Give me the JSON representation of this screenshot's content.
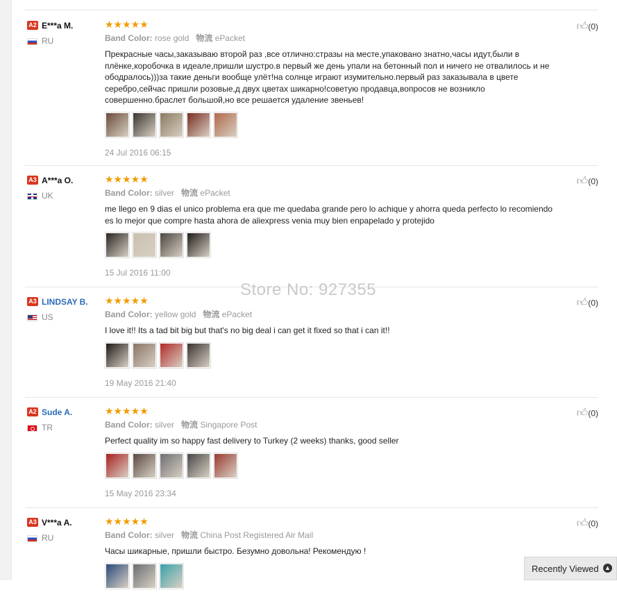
{
  "watermark": "Store No: 927355",
  "recently_viewed": "Recently Viewed",
  "reviews": [
    {
      "level": "A2",
      "name": "E***a M.",
      "flag": "ru",
      "country": "RU",
      "stars": "★★★★★",
      "color_key": "Band Color:",
      "color_val": "rose gold",
      "ship_key": "物流",
      "ship_val": "ePacket",
      "text": "Прекрасные часы,заказываю второй раз ,все отлично:стразы на месте,упаковано знатно,часы идут,были в плёнке,коробочка в идеале,пришли шустро.в первый же день упали на бетонный пол и ничего не отвалилось и не ободралось)))за такие деньги вообще улёт!на солнце играют изумительно.первый раз заказывала в цвете серебро,сейчас пришли розовые,д двух цветах шикарно!советую продавца,вопросов не возникло совершенно.браслет большой,но все решается удаление звеньев!",
      "date": "24 Jul 2016 06:15",
      "likes": "(0)",
      "thumbs": [
        "#6b4b3a",
        "#3a3530",
        "#8a7a60",
        "#7a2c22",
        "#b0684a"
      ]
    },
    {
      "level": "A3",
      "name": "A***a O.",
      "flag": "uk",
      "country": "UK",
      "stars": "★★★★★",
      "color_key": "Band Color:",
      "color_val": "silver",
      "ship_key": "物流",
      "ship_val": "ePacket",
      "text": "me llego en 9 dias el unico problema era que me quedaba grande pero lo achique y ahorra queda perfecto lo recomiendo es lo mejor que compre hasta ahora de aliexpress venia muy bien enpapelado y protejido",
      "date": "15 Jul 2016 11:00",
      "likes": "(0)",
      "thumbs": [
        "#2a2522",
        "#c8bfae",
        "#4a4640",
        "#1e1c1a"
      ]
    },
    {
      "level": "A3",
      "name": "LINDSAY B.",
      "flag": "us",
      "country": "US",
      "stars": "★★★★★",
      "color_key": "Band Color:",
      "color_val": "yellow gold",
      "ship_key": "物流",
      "ship_val": "ePacket",
      "text": "I love it!! Its a tad bit big but that's no big deal i can get it fixed so that i can it!!",
      "date": "19 May 2016 21:40",
      "likes": "(0)",
      "thumbs": [
        "#1e1a18",
        "#8a7466",
        "#b02a2a",
        "#3a3230"
      ]
    },
    {
      "level": "A2",
      "name": "Sude A.",
      "flag": "tr",
      "country": "TR",
      "stars": "★★★★★",
      "color_key": "Band Color:",
      "color_val": "silver",
      "ship_key": "物流",
      "ship_val": "Singapore Post",
      "text": "Perfect quality im so happy fast delivery to Turkey (2 weeks) thanks, good seller",
      "date": "15 May 2016 23:34",
      "likes": "(0)",
      "thumbs": [
        "#a82020",
        "#5a4a44",
        "#6e6e72",
        "#484848",
        "#9a3a30"
      ]
    },
    {
      "level": "A3",
      "name": "V***a A.",
      "flag": "ru",
      "country": "RU",
      "stars": "★★★★★",
      "color_key": "Band Color:",
      "color_val": "silver",
      "ship_key": "物流",
      "ship_val": "China Post Registered Air Mail",
      "text": "Часы шикарные, пришли быстро. Безумно довольна! Рекомендую !",
      "date": "",
      "likes": "(0)",
      "thumbs": [
        "#2a4a7a",
        "#6a6e72",
        "#3aa0a8"
      ]
    }
  ]
}
